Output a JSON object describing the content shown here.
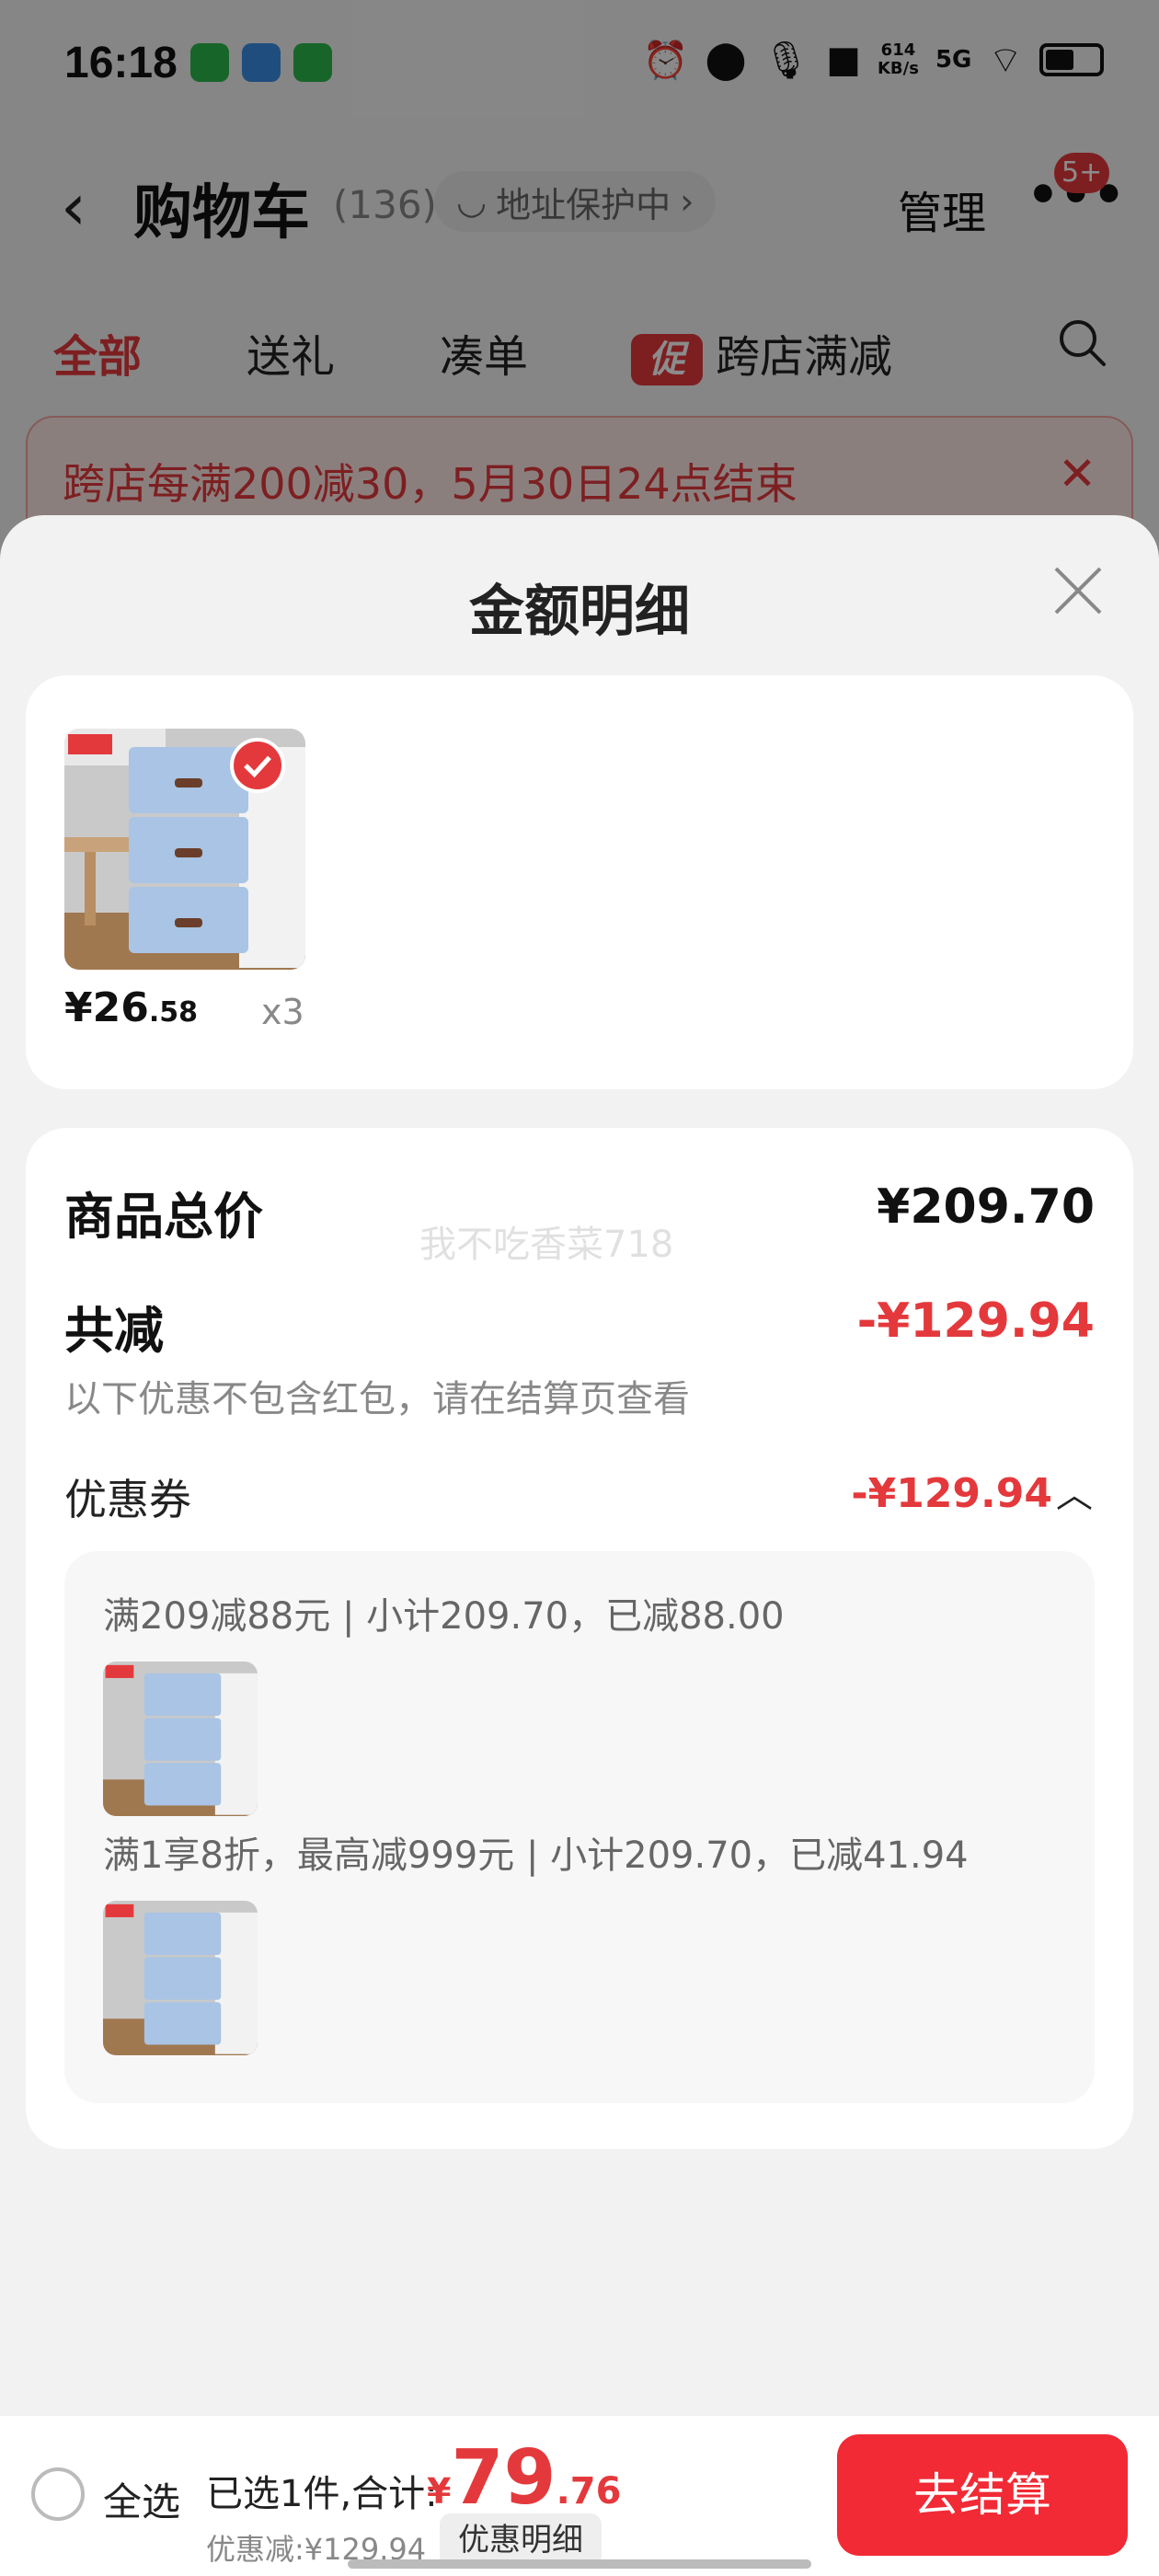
{
  "status_bar": {
    "time": "16:18",
    "net_speed_value": "614",
    "net_speed_unit": "KB/s",
    "network": "5G"
  },
  "nav": {
    "title": "购物车",
    "count": "(136)",
    "address_protect": "地址保护中",
    "manage": "管理",
    "badge": "5+"
  },
  "tabs": [
    {
      "label": "全部"
    },
    {
      "label": "送礼"
    },
    {
      "label": "凑单"
    },
    {
      "label": "跨店满减",
      "tag": "促"
    }
  ],
  "notice": {
    "text": "跨店每满200减30，5月30日24点结束"
  },
  "sheet": {
    "title": "金额明细",
    "product": {
      "price_int": "¥26",
      "price_dec": ".58",
      "qty": "x3"
    },
    "total_label": "商品总价",
    "total_value": "¥209.70",
    "reduce_label": "共减",
    "reduce_value": "-¥129.94",
    "note": "以下优惠不包含红包，请在结算页查看",
    "coupon_label": "优惠券",
    "coupon_value": "-¥129.94",
    "coupons": [
      {
        "text": "满209减88元 | 小计209.70，已减88.00"
      },
      {
        "text": "满1享8折，最高减999元 | 小计209.70，已减41.94"
      }
    ],
    "watermark": "我不吃香菜718"
  },
  "bottom": {
    "select_all": "全选",
    "summary_label": "已选1件,合计:",
    "currency": "¥",
    "total_int": "79",
    "total_dec": ".76",
    "saved": "优惠减:¥129.94",
    "detail_button": "优惠明细",
    "checkout": "去结算"
  },
  "colors": {
    "accent": "#e4393c",
    "checkout": "#f12a35"
  }
}
